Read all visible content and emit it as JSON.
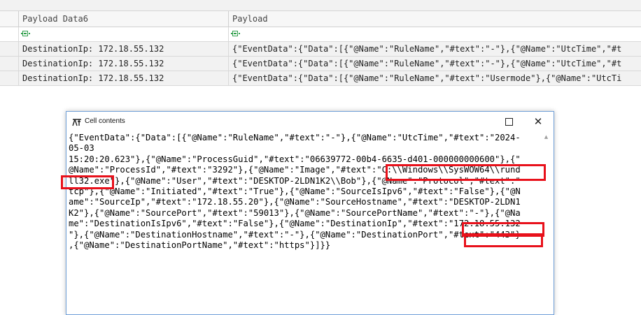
{
  "grid": {
    "columns": [
      {
        "label": "Payload Data6"
      },
      {
        "label": "Payload"
      }
    ],
    "rows": [
      {
        "data6": "DestinationIp: 172.18.55.132",
        "payload": "{\"EventData\":{\"Data\":[{\"@Name\":\"RuleName\",\"#text\":\"-\"},{\"@Name\":\"UtcTime\",\"#t"
      },
      {
        "data6": "DestinationIp: 172.18.55.132",
        "payload": "{\"EventData\":{\"Data\":[{\"@Name\":\"RuleName\",\"#text\":\"-\"},{\"@Name\":\"UtcTime\",\"#t"
      },
      {
        "data6": "DestinationIp: 172.18.55.132",
        "payload": "{\"EventData\":{\"Data\":[{\"@Name\":\"RuleName\",\"#text\":\"Usermode\"},{\"@Name\":\"UtcTi"
      }
    ]
  },
  "cell_window": {
    "title": "Cell contents",
    "minimize_label": "—",
    "close_label": "✕",
    "lines": [
      "{\"EventData\":{\"Data\":[{\"@Name\":\"RuleName\",\"#text\":\"-\"},{\"@Name\":\"UtcTime\",\"#text\":\"2024-",
      "05-03",
      "15:20:20.623\"},{\"@Name\":\"ProcessGuid\",\"#text\":\"06639772-00b4-6635-d401-000000000600\"},{\"",
      "@Name\":\"ProcessId\",\"#text\":\"3292\"},{\"@Name\":\"Image\",\"#text\":\"C:\\\\Windows\\\\SysWOW64\\\\rund",
      "ll32.exe\"},{\"@Name\":\"User\",\"#text\":\"DESKTOP-2LDN1K2\\\\Bob\"},{\"@Name\":\"Protocol\",\"#text\":\"",
      "tcp\"},{\"@Name\":\"Initiated\",\"#text\":\"True\"},{\"@Name\":\"SourceIsIpv6\",\"#text\":\"False\"},{\"@N",
      "ame\":\"SourceIp\",\"#text\":\"172.18.55.20\"},{\"@Name\":\"SourceHostname\",\"#text\":\"DESKTOP-2LDN1",
      "K2\"},{\"@Name\":\"SourcePort\",\"#text\":\"59013\"},{\"@Name\":\"SourcePortName\",\"#text\":\"-\"},{\"@Na",
      "me\":\"DestinationIsIpv6\",\"#text\":\"False\"},{\"@Name\":\"DestinationIp\",\"#text\":\"172.18.55.132",
      "\"},{\"@Name\":\"DestinationHostname\",\"#text\":\"-\"},{\"@Name\":\"DestinationPort\",\"#text\":\"443\"}",
      ",{\"@Name\":\"DestinationPortName\",\"#text\":\"https\"}]}}"
    ]
  },
  "highlight_color": "#e8111b",
  "filter_icon_color": "#2e9e4a",
  "icons": {
    "filter": "filter-icon",
    "window": "tool-icon",
    "maximize": "maximize-icon",
    "scroll_up": "scroll-up-arrow-icon"
  }
}
